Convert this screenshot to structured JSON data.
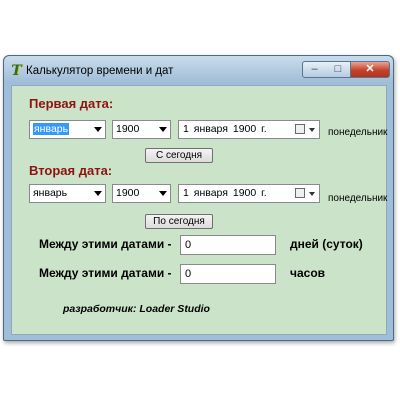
{
  "window": {
    "title": "Калькулятор времени и дат",
    "min_glyph": "–",
    "max_glyph": "□",
    "close_glyph": "✕"
  },
  "first_date": {
    "label": "Первая дата:",
    "month": "январь",
    "year": "1900",
    "date_text": "1  января  1900 г.",
    "weekday": "понедельник",
    "button": "С сегодня"
  },
  "second_date": {
    "label": "Вторая дата:",
    "month": "январь",
    "year": "1900",
    "date_text": "1  января  1900 г.",
    "weekday": "понедельник",
    "button": "По сегодня"
  },
  "results": {
    "days_label": "Между этими датами -",
    "days_value": "0",
    "days_unit": "дней (суток)",
    "hours_label": "Между этими датами -",
    "hours_value": "0",
    "hours_unit": "часов"
  },
  "footer": {
    "developer": "разработчик: Loader Studio"
  },
  "icons": [
    "app-icon",
    "minimize-icon",
    "maximize-icon",
    "close-icon",
    "calendar-icon",
    "chevron-down-icon"
  ],
  "colors": {
    "client_bg": "#cbe3c8",
    "section_label": "#8e1212",
    "selection": "#3399ff",
    "close_button": "#c4422b"
  }
}
